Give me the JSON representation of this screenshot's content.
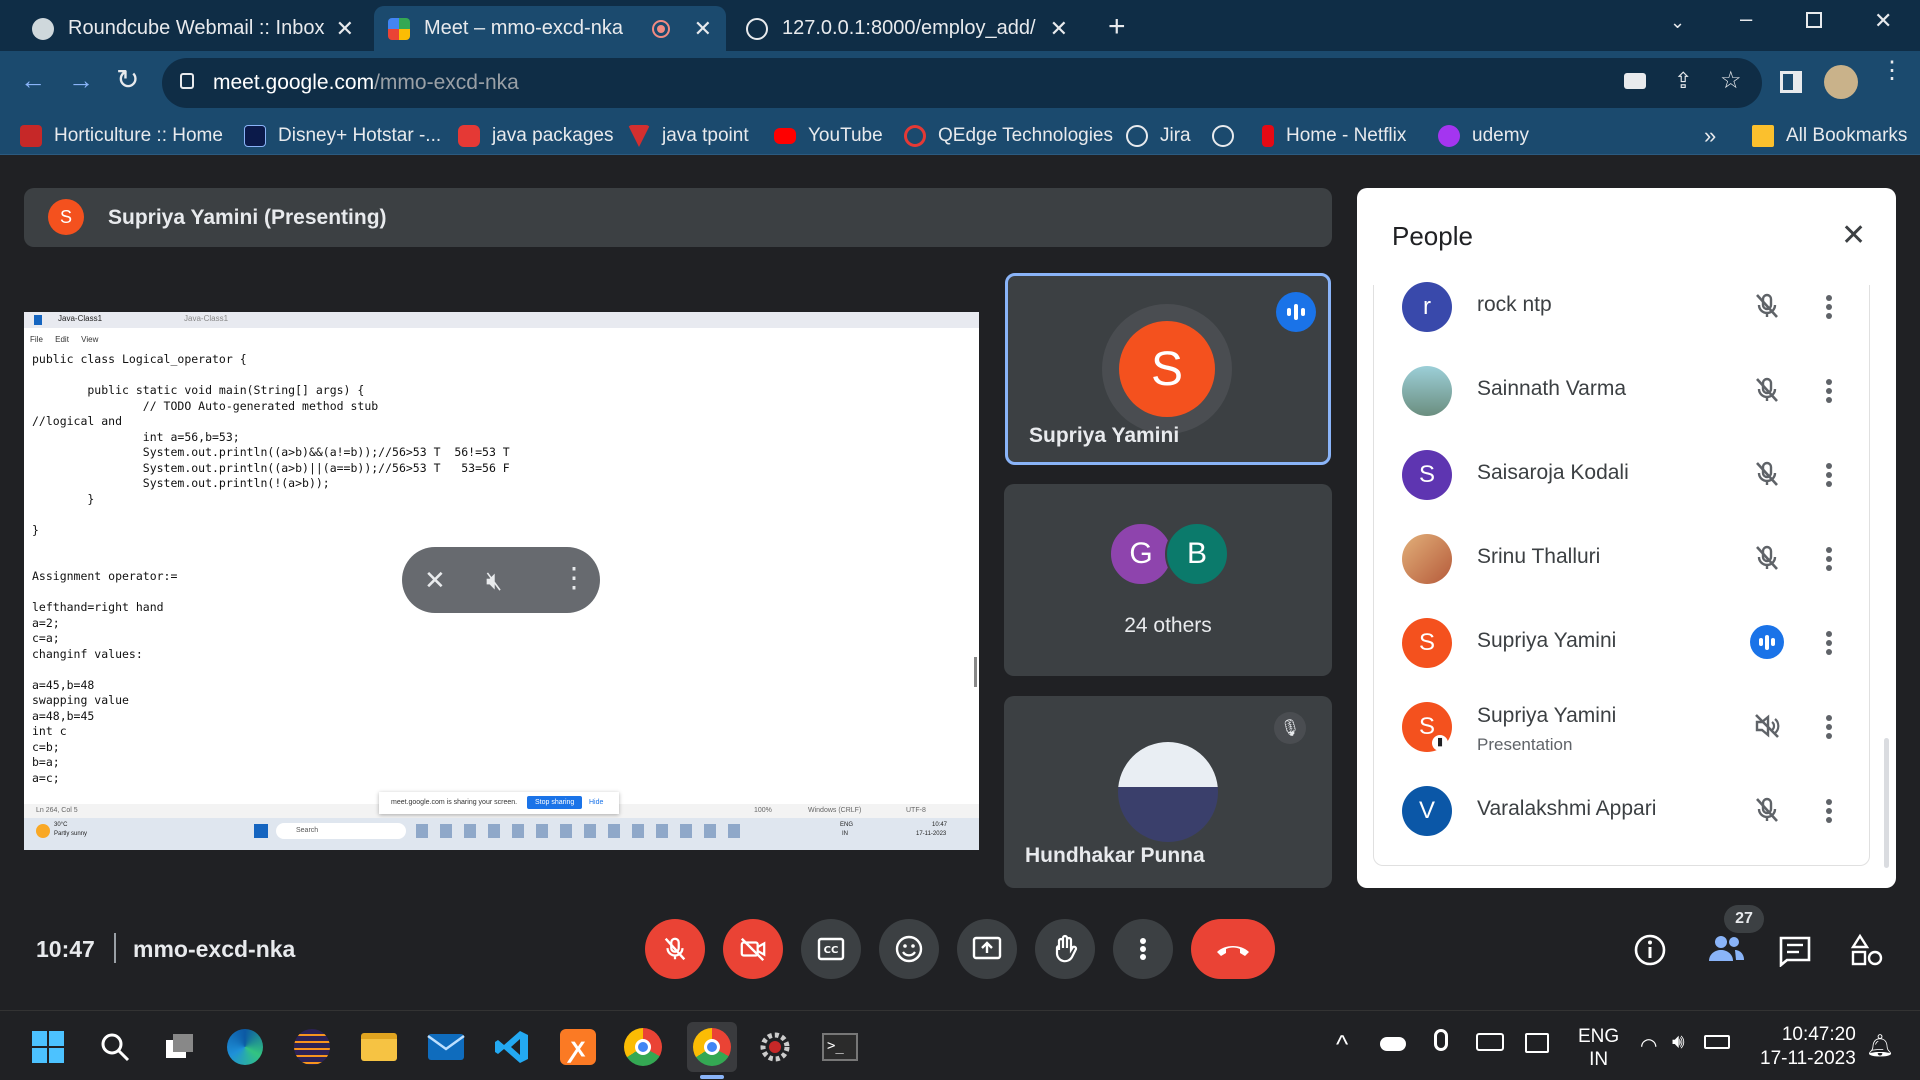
{
  "browser": {
    "tabs": [
      {
        "title": "Roundcube Webmail :: Inbox",
        "active": false
      },
      {
        "title": "Meet – mmo-excd-nka",
        "active": true
      },
      {
        "title": "127.0.0.1:8000/employ_add/",
        "active": false
      }
    ],
    "url_host": "meet.google.com",
    "url_path": "/mmo-excd-nka",
    "bookmarks": [
      {
        "label": "Horticulture :: Home",
        "color": "#c62828"
      },
      {
        "label": "Disney+ Hotstar -...",
        "color": "#0b1a4a"
      },
      {
        "label": "java packages",
        "color": "#e53935"
      },
      {
        "label": "java tpoint",
        "color": "#d32f2f"
      },
      {
        "label": "YouTube",
        "color": "#ff0000"
      },
      {
        "label": "QEdge Technologies",
        "color": "#e53935"
      },
      {
        "label": "Jira",
        "color": "#e8eaed"
      },
      {
        "label": "",
        "color": "#e8eaed"
      },
      {
        "label": "Home - Netflix",
        "color": "#e50914"
      },
      {
        "label": "udemy",
        "color": "#a435f0"
      }
    ],
    "more_bookmarks": "»",
    "all_bookmarks": "All Bookmarks"
  },
  "meet": {
    "presenter_initial": "S",
    "presenting_label": "Supriya Yamini (Presenting)",
    "shared_screen": {
      "tab1": "Java-Class1",
      "tab2": "Java-Class1",
      "menu": [
        "File",
        "Edit",
        "View"
      ],
      "code": "public class Logical_operator {\n\n        public static void main(String[] args) {\n                // TODO Auto-generated method stub\n//logical and\n                int a=56,b=53;\n                System.out.println((a>b)&&(a!=b));//56>53 T  56!=53 T\n                System.out.println((a>b)||(a==b));//56>53 T   53=56 F\n                System.out.println(!(a>b));\n        }\n\n}\n\n\nAssignment operator:=\n\nlefthand=right hand\na=2;\nc=a;\nchanginf values:\n\na=45,b=48\nswapping value\na=48,b=45\nint c\nc=b;\nb=a;\na=c;",
      "status_left": "Ln 264, Col 5",
      "status_zoom": "100%",
      "status_eol": "Windows (CRLF)",
      "status_enc": "UTF-8",
      "share_notice": "meet.google.com is sharing your screen.",
      "stop_sharing": "Stop sharing",
      "hide": "Hide",
      "weather_temp": "30°C",
      "weather_desc": "Partly sunny",
      "search": "Search",
      "lang1": "ENG",
      "lang2": "IN",
      "time": "10:47",
      "date": "17-11-2023"
    },
    "tiles": [
      {
        "name": "Supriya Yamini",
        "initial": "S",
        "color": "#f4511e"
      },
      {
        "name": "24 others",
        "initials": [
          "G",
          "B"
        ],
        "colors": [
          "#8e44ad",
          "#0b7a6b"
        ]
      },
      {
        "name": "Hundhakar Punna"
      }
    ],
    "people_panel": {
      "title": "People",
      "participants": [
        {
          "name": "rock ntp",
          "initial": "r",
          "color": "#3949ab",
          "sub": ""
        },
        {
          "name": "Sainnath Varma",
          "initial": "",
          "color": "#6b8e7f",
          "sub": ""
        },
        {
          "name": "Saisaroja Kodali",
          "initial": "S",
          "color": "#5e35b1",
          "sub": ""
        },
        {
          "name": "Srinu Thalluri",
          "initial": "",
          "color": "#b55a3a",
          "sub": ""
        },
        {
          "name": "Supriya Yamini",
          "initial": "S",
          "color": "#f4511e",
          "sub": ""
        },
        {
          "name": "Supriya Yamini",
          "initial": "S",
          "color": "#f4511e",
          "sub": "Presentation"
        },
        {
          "name": "Varalakshmi Appari",
          "initial": "V",
          "color": "#0b57a7",
          "sub": ""
        }
      ]
    },
    "bottom": {
      "time": "10:47",
      "meeting_code": "mmo-excd-nka",
      "participant_count": "27"
    }
  },
  "taskbar": {
    "lang1": "ENG",
    "lang2": "IN",
    "time": "10:47:20",
    "date": "17-11-2023"
  }
}
